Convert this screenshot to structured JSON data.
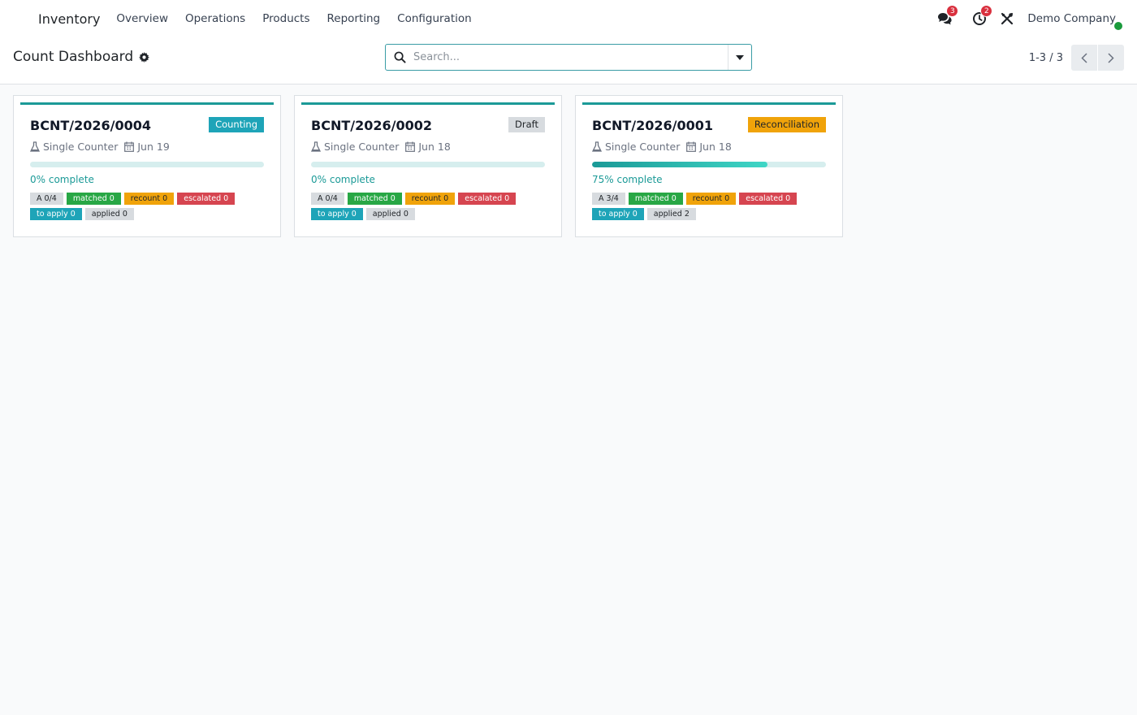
{
  "topbar": {
    "brand": "Inventory",
    "menu": [
      "Overview",
      "Operations",
      "Products",
      "Reporting",
      "Configuration"
    ],
    "messages_count": "3",
    "activities_count": "2",
    "company": "Demo Company",
    "icons": [
      "apps-icon",
      "chat-icon",
      "clock-icon",
      "tools-icon"
    ]
  },
  "control": {
    "title": "Count Dashboard",
    "search_placeholder": "Search...",
    "pager": "1-3 / 3"
  },
  "colors": {
    "accent": "#1b9a97",
    "counting": "#1ea4b8",
    "draft": "#d7dbdf",
    "reconciliation": "#f0a30a",
    "matched": "#28a745",
    "escalated": "#d64550",
    "online": "#1a9a3c"
  },
  "cards": [
    {
      "ref": "BCNT/2026/0004",
      "state": "Counting",
      "counter": "Single Counter",
      "date": "Jun 19",
      "progress": 0,
      "pct_label": "0% complete",
      "chips": {
        "area": "A 0/4",
        "matched": "matched 0",
        "recount": "recount 0",
        "escalated": "escalated 0",
        "to_apply": "to apply 0",
        "applied": "applied 0"
      }
    },
    {
      "ref": "BCNT/2026/0002",
      "state": "Draft",
      "counter": "Single Counter",
      "date": "Jun 18",
      "progress": 0,
      "pct_label": "0% complete",
      "chips": {
        "area": "A 0/4",
        "matched": "matched 0",
        "recount": "recount 0",
        "escalated": "escalated 0",
        "to_apply": "to apply 0",
        "applied": "applied 0"
      }
    },
    {
      "ref": "BCNT/2026/0001",
      "state": "Reconciliation",
      "counter": "Single Counter",
      "date": "Jun 18",
      "progress": 0.75,
      "pct_label": "75% complete",
      "chips": {
        "area": "A 3/4",
        "matched": "matched 0",
        "recount": "recount 0",
        "escalated": "escalated 0",
        "to_apply": "to apply 0",
        "applied": "applied 2"
      }
    }
  ]
}
